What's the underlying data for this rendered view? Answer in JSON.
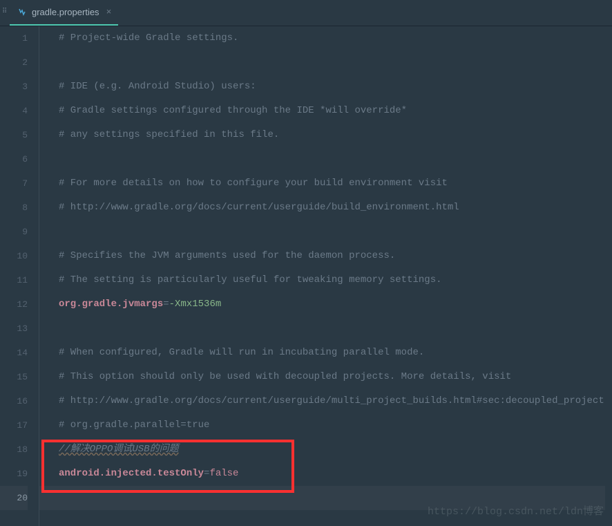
{
  "tab": {
    "filename": "gradle.properties",
    "close_icon": "×"
  },
  "lines": [
    {
      "num": "1",
      "content": [
        {
          "cls": "comment",
          "text": "# Project-wide Gradle settings."
        }
      ]
    },
    {
      "num": "2",
      "content": []
    },
    {
      "num": "3",
      "content": [
        {
          "cls": "comment",
          "text": "# IDE (e.g. Android Studio) users:"
        }
      ]
    },
    {
      "num": "4",
      "content": [
        {
          "cls": "comment",
          "text": "# Gradle settings configured through the IDE *will override*"
        }
      ]
    },
    {
      "num": "5",
      "content": [
        {
          "cls": "comment",
          "text": "# any settings specified in this file."
        }
      ]
    },
    {
      "num": "6",
      "content": []
    },
    {
      "num": "7",
      "content": [
        {
          "cls": "comment",
          "text": "# For more details on how to configure your build environment visit"
        }
      ]
    },
    {
      "num": "8",
      "content": [
        {
          "cls": "comment",
          "text": "# http://www.gradle.org/docs/current/userguide/build_environment.html"
        }
      ]
    },
    {
      "num": "9",
      "content": []
    },
    {
      "num": "10",
      "content": [
        {
          "cls": "comment",
          "text": "# Specifies the JVM arguments used for the daemon process."
        }
      ]
    },
    {
      "num": "11",
      "content": [
        {
          "cls": "comment",
          "text": "# The setting is particularly useful for tweaking memory settings."
        }
      ]
    },
    {
      "num": "12",
      "content": [
        {
          "cls": "keyword",
          "text": "org.gradle.jvmargs"
        },
        {
          "cls": "operator",
          "text": "="
        },
        {
          "cls": "value-flag",
          "text": "-Xmx1536m"
        }
      ]
    },
    {
      "num": "13",
      "content": []
    },
    {
      "num": "14",
      "content": [
        {
          "cls": "comment",
          "text": "# When configured, Gradle will run in incubating parallel mode."
        }
      ]
    },
    {
      "num": "15",
      "content": [
        {
          "cls": "comment",
          "text": "# This option should only be used with decoupled projects. More details, visit"
        }
      ]
    },
    {
      "num": "16",
      "content": [
        {
          "cls": "comment",
          "text": "# http://www.gradle.org/docs/current/userguide/multi_project_builds.html#sec:decoupled_projects"
        }
      ]
    },
    {
      "num": "17",
      "content": [
        {
          "cls": "comment",
          "text": "# org.gradle.parallel=true"
        }
      ]
    },
    {
      "num": "18",
      "content": [
        {
          "cls": "slash-comment",
          "text": "//解决OPPO调试USB的问题"
        }
      ]
    },
    {
      "num": "19",
      "content": [
        {
          "cls": "keyword",
          "text": "android.injected.testOnly"
        },
        {
          "cls": "operator",
          "text": "="
        },
        {
          "cls": "value-false",
          "text": "false"
        }
      ]
    },
    {
      "num": "20",
      "content": [],
      "current": true
    }
  ],
  "watermark": "https://blog.csdn.net/ldn博客"
}
